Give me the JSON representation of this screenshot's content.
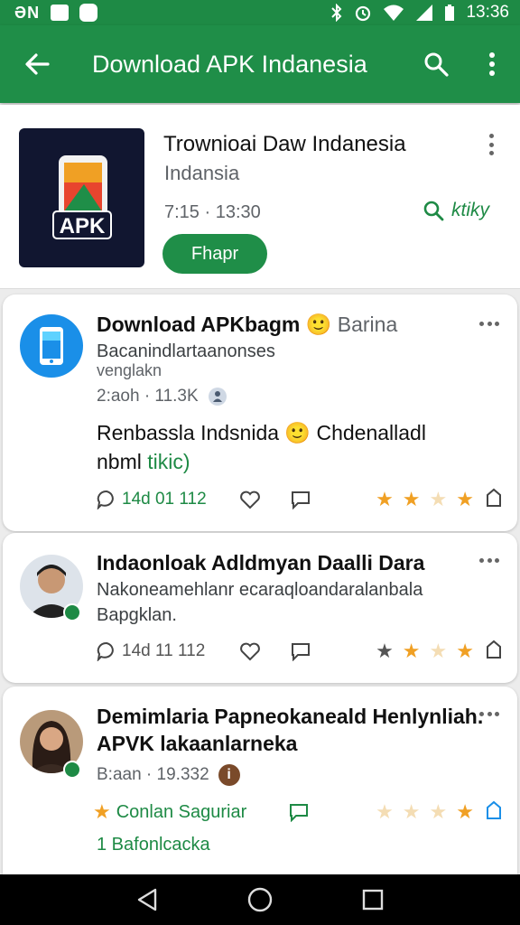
{
  "status_bar": {
    "left_glyphs": "ƏN",
    "time": "13:36"
  },
  "app_bar": {
    "title": "Download APK Indanesia"
  },
  "app": {
    "title": "Trownioai Daw Indanesia",
    "subtitle": "Indansia",
    "meta": "7:15 · 13:30",
    "link": "ktiky",
    "button": "Fhapr",
    "icon_text": "APK"
  },
  "posts": [
    {
      "name": "Download APKbagm",
      "emoji": "🙂",
      "name_extra": "Barina",
      "line1": "Bacanindlartaanonses",
      "line2": "venglakn",
      "meta": "2:aoh · 11.3K",
      "body1": "Renbassla Indsnida",
      "body_emoji": "🙂",
      "body1_extra": "Chdenalladl",
      "body2": "nbml",
      "body2_link": "tikic)",
      "count": "14d  01  112",
      "stars": [
        "full",
        "full",
        "pale",
        "full"
      ]
    },
    {
      "name": "Indaonloak Adldmyan Daalli Dara",
      "line1": "Nakoneamehlanr ecaraqloandaralanbala",
      "line2": "Bapgklan.",
      "count": "14d  11  112",
      "stars": [
        "dim",
        "full",
        "pale",
        "full"
      ]
    },
    {
      "name": "Demimlaria Papneokaneald Henlynliah.",
      "name2": "APVK lakaanlarneka",
      "meta": "B:aan · 19.332",
      "info_badge": "i",
      "link": "Conlan Saguriar",
      "link2": "1 Bafonlcacka",
      "stars": [
        "pale",
        "pale",
        "pale",
        "full"
      ]
    }
  ],
  "colors": {
    "accent": "#1f8e48",
    "star": "#f0a024"
  }
}
